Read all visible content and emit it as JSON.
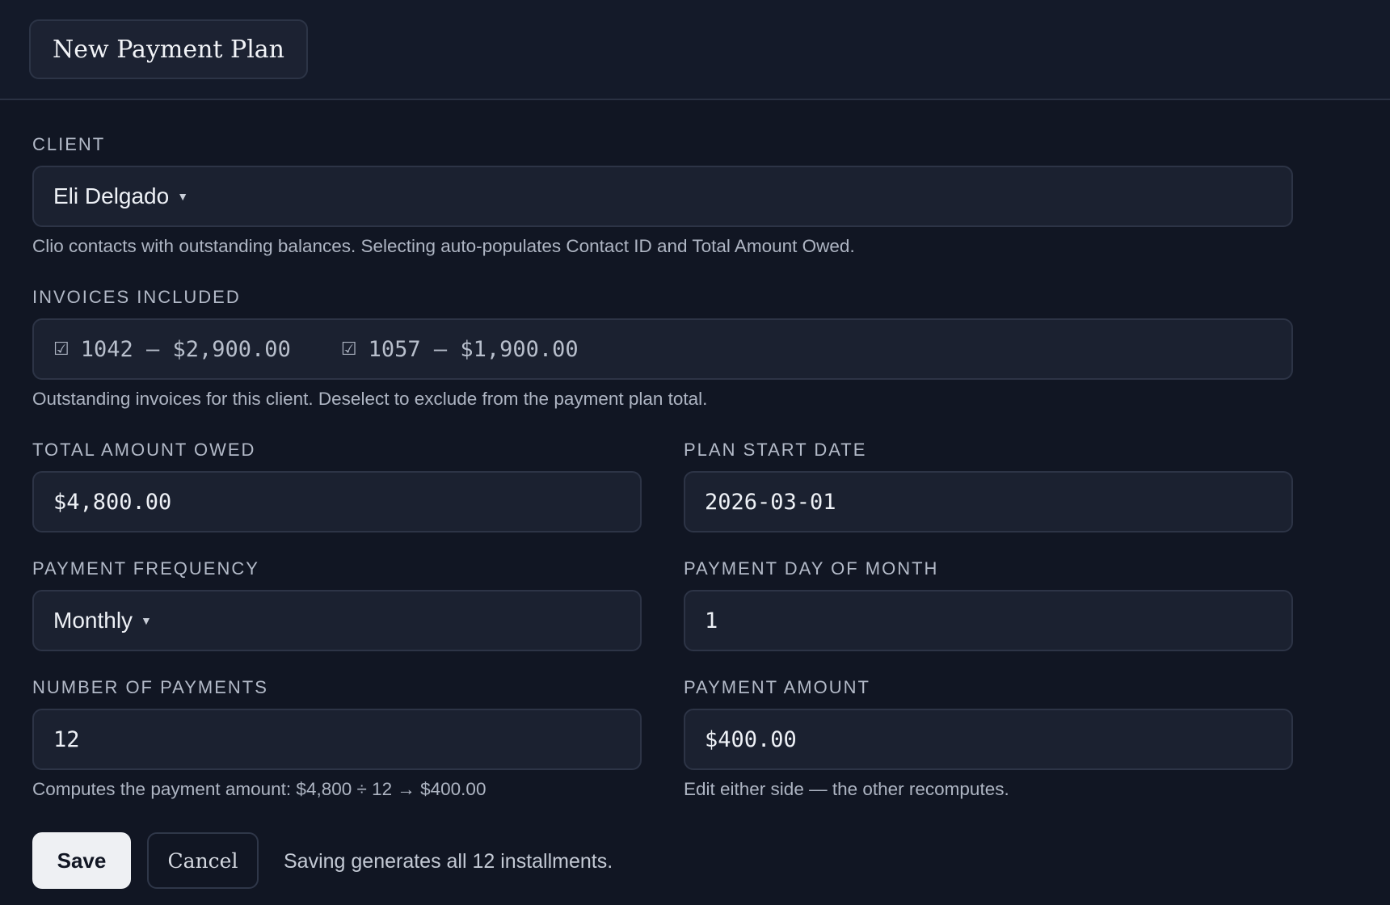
{
  "header": {
    "tab_label": "New Payment Plan"
  },
  "client": {
    "label": "CLIENT",
    "value": "Eli Delgado",
    "help": "Clio contacts with outstanding balances. Selecting auto-populates Contact ID and Total Amount Owed."
  },
  "invoices": {
    "label": "INVOICES INCLUDED",
    "items": [
      {
        "text": "1042 — $2,900.00",
        "checked": true
      },
      {
        "text": "1057 — $1,900.00",
        "checked": true
      }
    ],
    "help": "Outstanding invoices for this client. Deselect to exclude from the payment plan total."
  },
  "total_owed": {
    "label": "TOTAL AMOUNT OWED",
    "value": "$4,800.00"
  },
  "start_date": {
    "label": "PLAN START DATE",
    "value": "2026-03-01"
  },
  "frequency": {
    "label": "PAYMENT FREQUENCY",
    "value": "Monthly"
  },
  "day_of_month": {
    "label": "PAYMENT DAY OF MONTH",
    "value": "1"
  },
  "num_payments": {
    "label": "NUMBER OF PAYMENTS",
    "value": "12",
    "help": "Computes the payment amount: $4,800 ÷ 12 → $400.00"
  },
  "payment_amount": {
    "label": "PAYMENT AMOUNT",
    "value": "$400.00",
    "help": "Edit either side — the other recomputes."
  },
  "actions": {
    "save_label": "Save",
    "cancel_label": "Cancel",
    "note": "Saving generates all 12 installments."
  },
  "icons": {
    "checkbox": "checkbox-checked-icon",
    "dropdown": "caret-down-icon"
  },
  "colors": {
    "background": "#111623",
    "field_bg": "#1b2130",
    "save_bg": "#eef0f3"
  }
}
